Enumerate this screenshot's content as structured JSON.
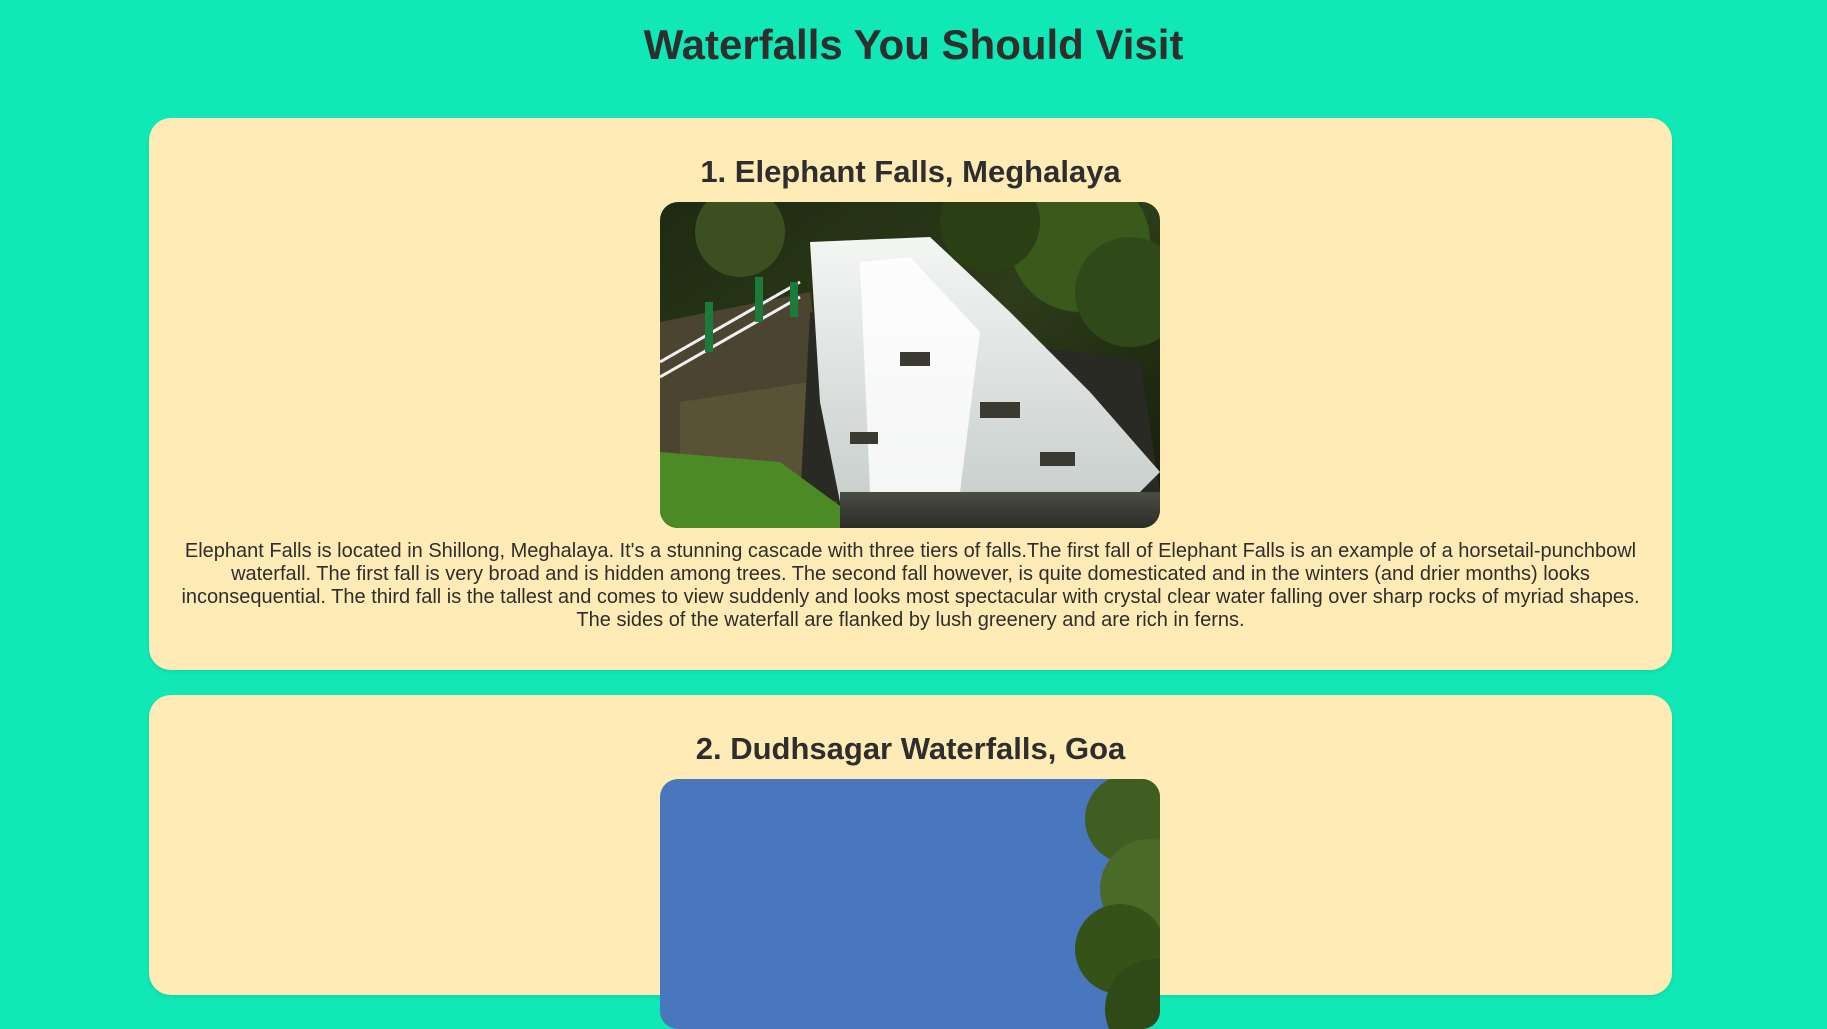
{
  "page": {
    "title": "Waterfalls You Should Visit",
    "background_color": "#10e8b6",
    "card_color": "#ffebb5"
  },
  "waterfalls": [
    {
      "heading": "1. Elephant Falls, Meghalaya",
      "image_subject": "elephant-falls-photo",
      "description": "Elephant Falls is located in Shillong, Meghalaya. It's a stunning cascade with three tiers of falls.The first fall of Elephant Falls is an example of a horsetail-punchbowl waterfall. The first fall is very broad and is hidden among trees. The second fall however, is quite domesticated and in the winters (and drier months) looks inconsequential. The third fall is the tallest and comes to view suddenly and looks most spectacular with crystal clear water falling over sharp rocks of myriad shapes. The sides of the waterfall are flanked by lush greenery and are rich in ferns."
    },
    {
      "heading": "2. Dudhsagar Waterfalls, Goa",
      "image_subject": "dudhsagar-falls-photo"
    }
  ]
}
